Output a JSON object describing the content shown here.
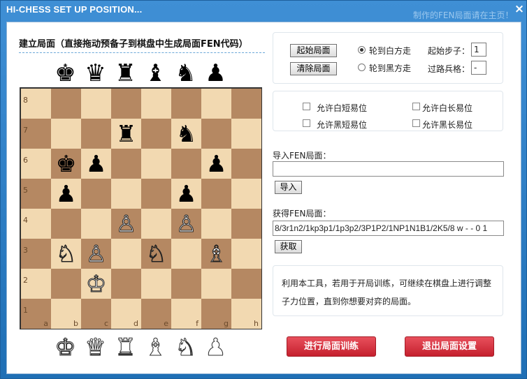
{
  "window": {
    "title": "HI-CHESS SET UP POSITION...",
    "background_text": "制作的FEN局面请在主页！",
    "close_symbol": "×"
  },
  "heading": "建立局面（直接拖动预备子到棋盘中生成局面FEN代码）",
  "tray_black": [
    "♚",
    "♛",
    "♜",
    "♝",
    "♞",
    "♟"
  ],
  "tray_white": [
    "♚",
    "♛",
    "♜",
    "♝",
    "♞",
    "♟"
  ],
  "board": {
    "files": [
      "a",
      "b",
      "c",
      "d",
      "e",
      "f",
      "g",
      "h"
    ],
    "ranks": [
      "8",
      "7",
      "6",
      "5",
      "4",
      "3",
      "2",
      "1"
    ],
    "pieces": [
      {
        "square": "d7",
        "glyph": "♜",
        "color": "black"
      },
      {
        "square": "f7",
        "glyph": "♞",
        "color": "black"
      },
      {
        "square": "b6",
        "glyph": "♚",
        "color": "black"
      },
      {
        "square": "c6",
        "glyph": "♟",
        "color": "black"
      },
      {
        "square": "g6",
        "glyph": "♟",
        "color": "black"
      },
      {
        "square": "b5",
        "glyph": "♟",
        "color": "black"
      },
      {
        "square": "f5",
        "glyph": "♟",
        "color": "black"
      },
      {
        "square": "d4",
        "glyph": "♙",
        "color": "white"
      },
      {
        "square": "f4",
        "glyph": "♙",
        "color": "white"
      },
      {
        "square": "b3",
        "glyph": "♘",
        "color": "white"
      },
      {
        "square": "c3",
        "glyph": "♙",
        "color": "white"
      },
      {
        "square": "e3",
        "glyph": "♘",
        "color": "white"
      },
      {
        "square": "g3",
        "glyph": "♗",
        "color": "white"
      },
      {
        "square": "c2",
        "glyph": "♔",
        "color": "white"
      }
    ]
  },
  "setup": {
    "start_position_button": "起始局面",
    "clear_position_button": "清除局面",
    "white_to_move": "轮到白方走",
    "black_to_move": "轮到黑方走",
    "selected_side": "white",
    "start_move_label": "起始步子：",
    "start_move_value": "1",
    "en_passant_label": "过路兵格：",
    "en_passant_value": "-"
  },
  "castling": {
    "white_short": "允许白短易位",
    "white_long": "允许白长易位",
    "black_short": "允许黑短易位",
    "black_long": "允许黑长易位"
  },
  "import": {
    "label": "导入FEN局面：",
    "value": "",
    "button": "导入"
  },
  "export": {
    "label": "获得FEN局面：",
    "value": "8/3r1n2/1kp3p1/1p3p2/3P1P2/1NP1N1B1/2K5/8 w - - 0 1",
    "button": "获取"
  },
  "note": "利用本工具，若用于开局训练，可继续在棋盘上进行调整子力位置，直到你想要对弈的局面。",
  "actions": {
    "train": "进行局面训练",
    "exit": "退出局面设置"
  },
  "colors": {
    "title_bar": "#2f7fc6",
    "light_square": "#f2d9b1",
    "dark_square": "#b58862",
    "action_button": "#d3333f"
  }
}
